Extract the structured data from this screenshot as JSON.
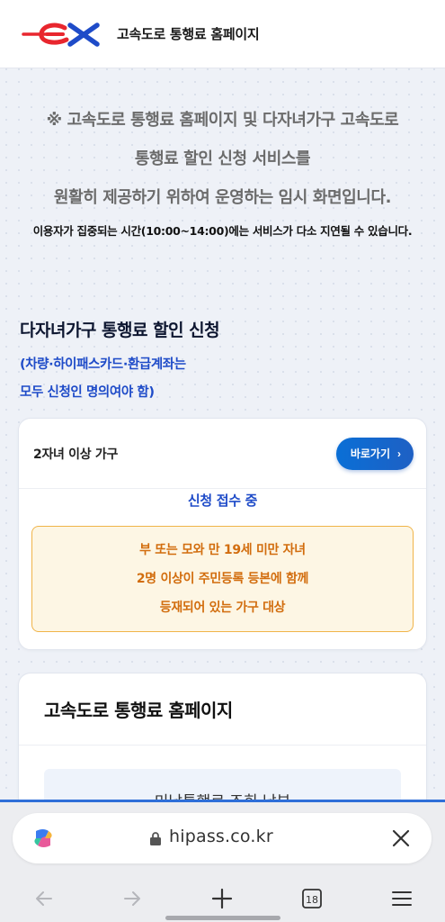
{
  "header": {
    "title": "고속도로 통행료 홈페이지"
  },
  "notice": {
    "lines": [
      "※ 고속도로 통행료 홈페이지 및 다자녀가구 고속도로",
      "통행료 할인 신청 서비스를",
      "원활히 제공하기 위하여 운영하는 임시 화면입니다."
    ],
    "sub": "이용자가 집중되는 시간(10:00~14:00)에는 서비스가 다소 지연될 수 있습니다."
  },
  "section": {
    "title": "다자녀가구 통행료 할인 신청",
    "note_lines": [
      "(차량·하이패스카드·환급계좌는",
      "모두 신청인 명의여야 함)"
    ]
  },
  "card1": {
    "title": "2자녀 이상 가구",
    "button_label": "바로가기",
    "status": "신청 접수 중",
    "info_lines": [
      "부 또는 모와 만 19세 미만 자녀",
      "2명 이상이 주민등록 등본에 함께",
      "등재되어 있는 가구 대상"
    ]
  },
  "card2": {
    "title": "고속도로 통행료 홈페이지",
    "inner_text": "미납통행료 조회·납부"
  },
  "browser": {
    "url": "hipass.co.kr",
    "tab_count": "18"
  },
  "colors": {
    "accent_blue": "#1e4bc8",
    "button_blue": "#0a6fd6",
    "info_orange": "#d26d0e",
    "info_border": "#f0b449",
    "logo_red": "#e8262e",
    "logo_blue": "#1e4bc8"
  },
  "icons": [
    "ex-logo",
    "copilot-icon",
    "lock-icon",
    "close-icon",
    "back-arrow-icon",
    "forward-arrow-icon",
    "plus-icon",
    "tabs-icon",
    "menu-icon"
  ]
}
